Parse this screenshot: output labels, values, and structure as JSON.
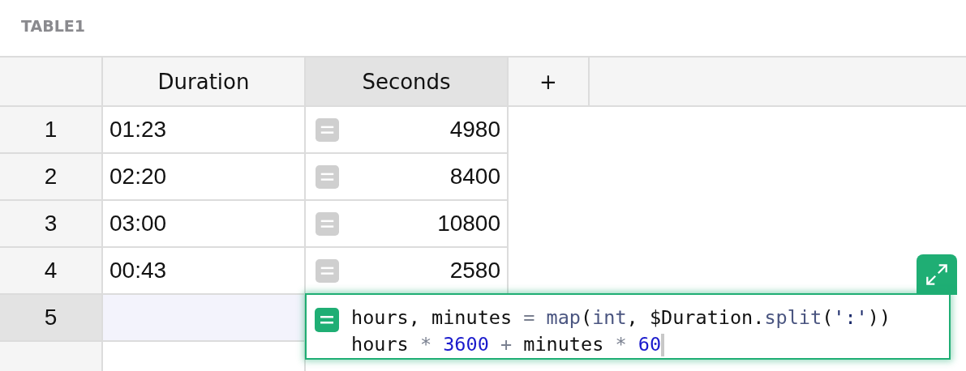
{
  "table_title": "TABLE1",
  "columns": [
    {
      "label": "Duration",
      "selected": false
    },
    {
      "label": "Seconds",
      "selected": true
    }
  ],
  "add_column": "+",
  "rows": [
    {
      "number": "1",
      "duration": "01:23",
      "seconds": "4980",
      "selected": false
    },
    {
      "number": "2",
      "duration": "02:20",
      "seconds": "8400",
      "selected": false
    },
    {
      "number": "3",
      "duration": "03:00",
      "seconds": "10800",
      "selected": false
    },
    {
      "number": "4",
      "duration": "00:43",
      "seconds": "2580",
      "selected": false
    },
    {
      "number": "5",
      "duration": "",
      "selected": true
    }
  ],
  "formula_editor": {
    "lines": [
      [
        {
          "text": "hours, minutes ",
          "kind": "plain"
        },
        {
          "text": "= ",
          "kind": "op"
        },
        {
          "text": "map",
          "kind": "func"
        },
        {
          "text": "(",
          "kind": "plain"
        },
        {
          "text": "int",
          "kind": "func"
        },
        {
          "text": ", $Duration.",
          "kind": "plain"
        },
        {
          "text": "split",
          "kind": "func"
        },
        {
          "text": "(",
          "kind": "plain"
        },
        {
          "text": "':'",
          "kind": "string"
        },
        {
          "text": "))",
          "kind": "plain"
        }
      ],
      [
        {
          "text": "hours ",
          "kind": "plain"
        },
        {
          "text": "* ",
          "kind": "op"
        },
        {
          "text": "3600 ",
          "kind": "num"
        },
        {
          "text": "+",
          "kind": "op"
        },
        {
          "text": " minutes ",
          "kind": "plain"
        },
        {
          "text": "* ",
          "kind": "op"
        },
        {
          "text": "60",
          "kind": "num"
        }
      ]
    ]
  }
}
